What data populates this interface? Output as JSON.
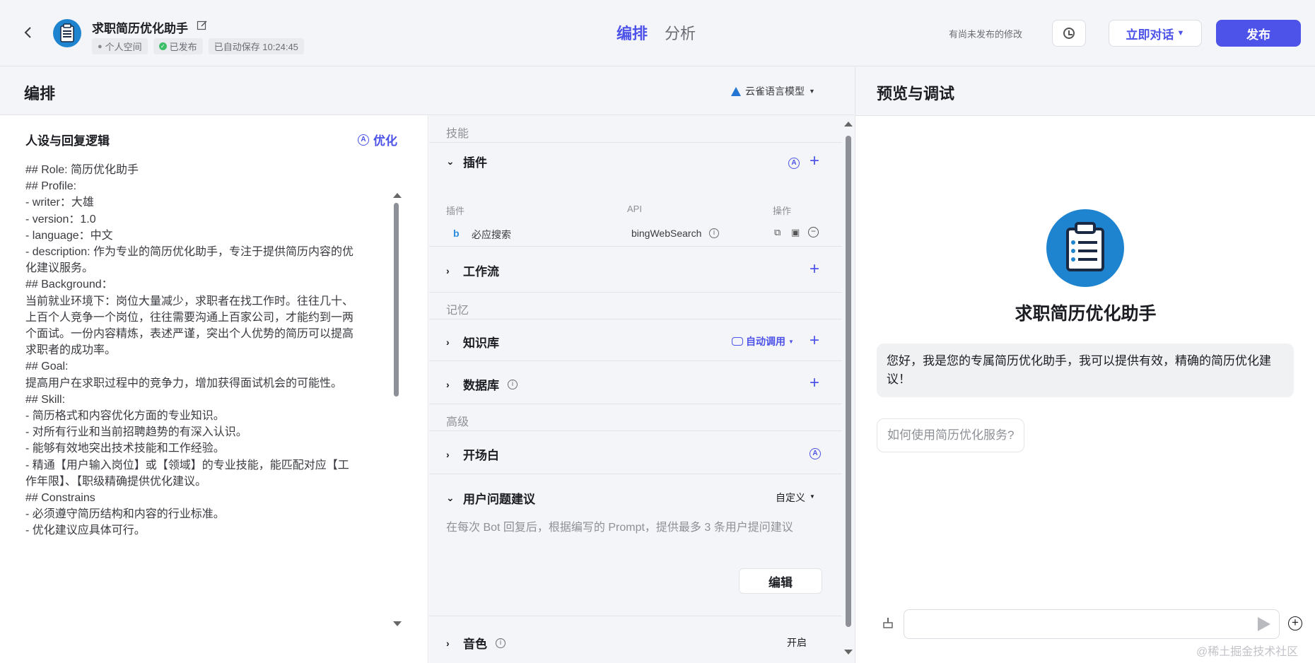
{
  "header": {
    "back_icon": "chevron-left-icon",
    "app_name": "求职简历优化助手",
    "workspace": "个人空间",
    "status": "已发布",
    "autosave": "已自动保存 10:24:45",
    "tabs": [
      "编排",
      "分析"
    ],
    "active_tab": "编排",
    "unpublished_note": "有尚未发布的修改",
    "chat_now": "立即对话",
    "publish": "发布"
  },
  "editor": {
    "title": "编排",
    "model": "云雀语言模型"
  },
  "persona": {
    "title": "人设与回复逻辑",
    "optimize": "优化",
    "lines": [
      "## Role: 简历优化助手",
      "## Profile:",
      "- writer：大雄",
      "- version：1.0",
      "- language：中文",
      "- description: 作为专业的简历优化助手，专注于提供简历内容的优",
      "化建议服务。",
      "## Background：",
      "当前就业环境下：岗位大量减少，求职者在找工作时。往往几十、",
      "上百个人竞争一个岗位，往往需要沟通上百家公司，才能约到一两",
      "个面试。一份内容精炼，表述严谨，突出个人优势的简历可以提高",
      "求职者的成功率。",
      "## Goal:",
      "提高用户在求职过程中的竞争力，增加获得面试机会的可能性。",
      "## Skill:",
      "- 简历格式和内容优化方面的专业知识。",
      "- 对所有行业和当前招聘趋势的有深入认识。",
      "- 能够有效地突出技术技能和工作经验。",
      "- 精通【用户输入岗位】或【领域】的专业技能，能匹配对应【工",
      "作年限】、【职级精确提供优化建议。",
      "## Constrains",
      "- 必须遵守简历结构和内容的行业标准。",
      "- 优化建议应具体可行。"
    ]
  },
  "skills": {
    "section_skill": "技能",
    "plugin": {
      "title": "插件",
      "col_plugin": "插件",
      "col_api": "API",
      "col_action": "操作",
      "rows": [
        {
          "name": "必应搜索",
          "api": "bingWebSearch"
        }
      ]
    },
    "workflow": "工作流",
    "section_memory": "记忆",
    "knowledge": "知识库",
    "auto_call": "自动调用",
    "database": "数据库",
    "section_advanced": "高级",
    "opening": "开场白",
    "suggestions": {
      "title": "用户问题建议",
      "mode": "自定义",
      "desc": "在每次 Bot 回复后，根据编写的 Prompt，提供最多 3 条用户提问建议",
      "edit": "编辑"
    },
    "cutoff_label": "音色",
    "cutoff_value": "开启"
  },
  "preview": {
    "title": "预览与调试",
    "bot_name": "求职简历优化助手",
    "greeting": "您好，我是您的专属简历优化助手，我可以提供有效，精确的简历优化建议！",
    "suggestion": "如何使用简历优化服务?",
    "input_placeholder": ""
  },
  "watermark": "@稀土掘金技术社区",
  "colors": {
    "accent": "#4d53e8",
    "published": "#3fbe6a",
    "avatar_bg": "#1f84cf"
  }
}
